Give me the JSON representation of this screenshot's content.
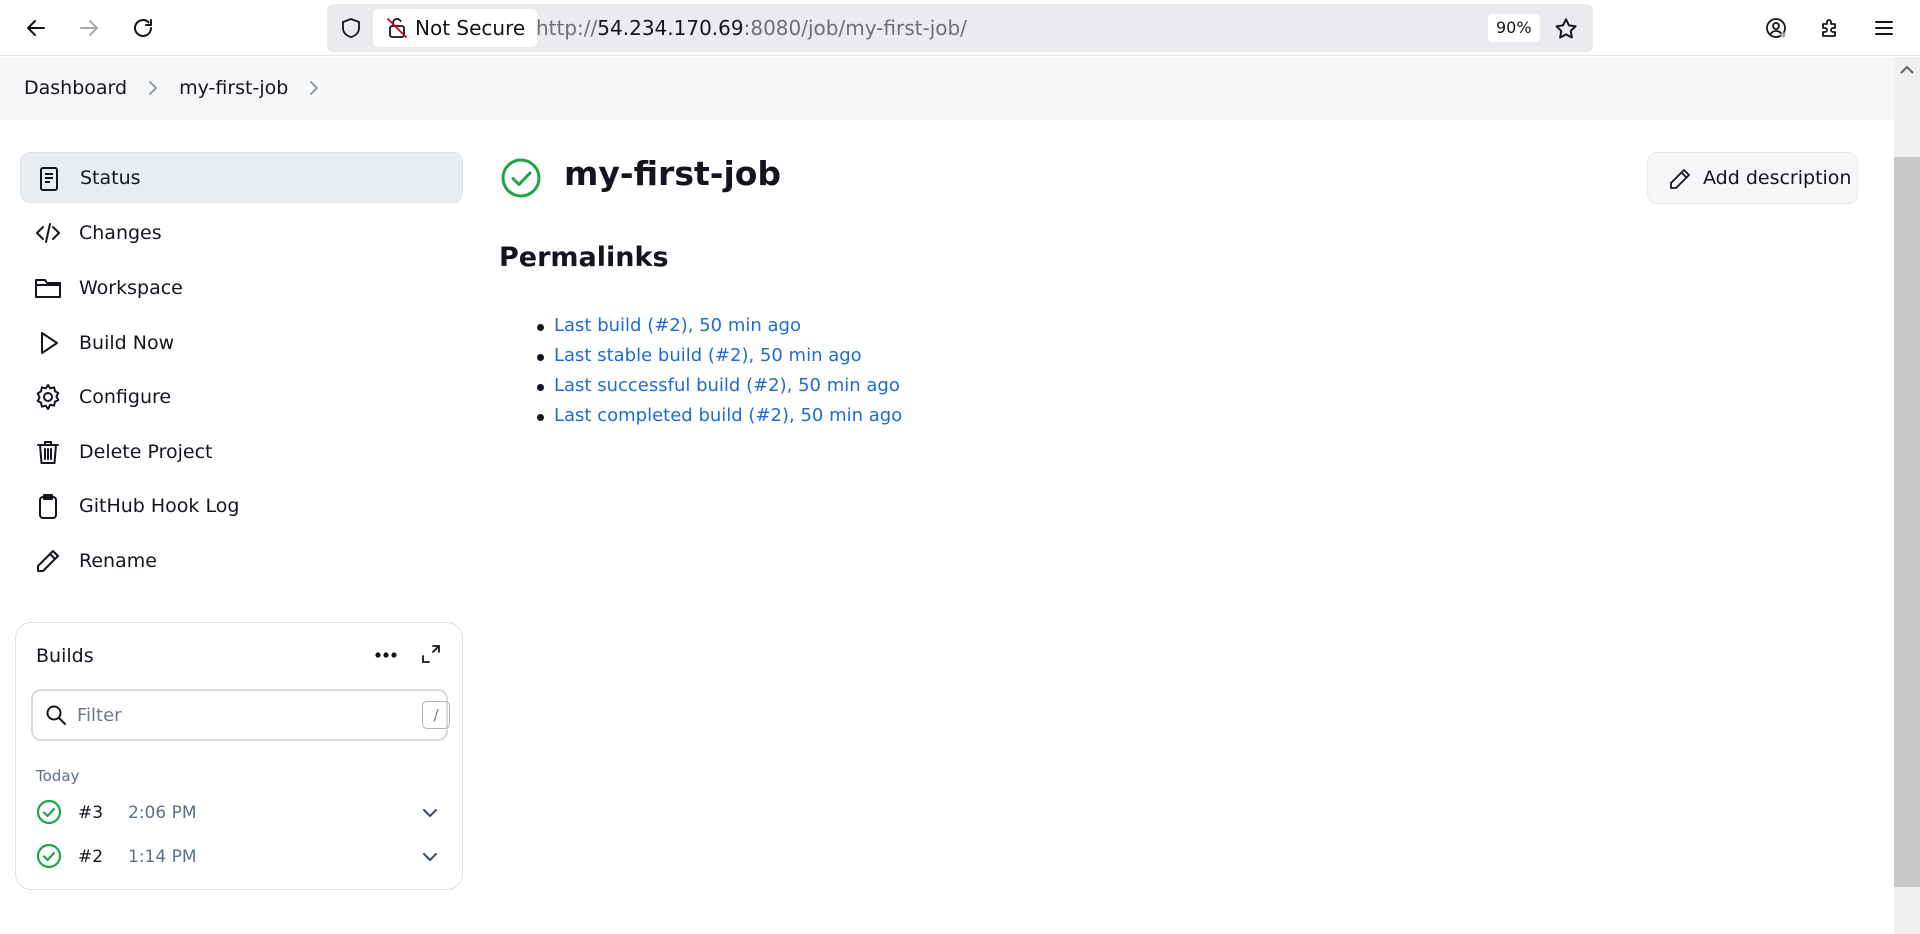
{
  "browser": {
    "security_label": "Not Secure",
    "url_prefix": "http://",
    "url_host": "54.234.170.69",
    "url_rest": ":8080/job/my-first-job/",
    "zoom": "90%"
  },
  "breadcrumb": {
    "items": [
      "Dashboard",
      "my-first-job"
    ]
  },
  "sidebar": {
    "items": [
      {
        "label": "Status",
        "icon": "status-icon",
        "active": true
      },
      {
        "label": "Changes",
        "icon": "code-icon"
      },
      {
        "label": "Workspace",
        "icon": "folder-icon"
      },
      {
        "label": "Build Now",
        "icon": "play-icon"
      },
      {
        "label": "Configure",
        "icon": "gear-icon"
      },
      {
        "label": "Delete Project",
        "icon": "trash-icon"
      },
      {
        "label": "GitHub Hook Log",
        "icon": "clipboard-icon"
      },
      {
        "label": "Rename",
        "icon": "pencil-icon"
      }
    ]
  },
  "builds": {
    "title": "Builds",
    "filter_placeholder": "Filter",
    "filter_shortcut": "/",
    "group_label": "Today",
    "rows": [
      {
        "number": "#3",
        "time": "2:06 PM",
        "status": "success"
      },
      {
        "number": "#2",
        "time": "1:14 PM",
        "status": "success"
      }
    ]
  },
  "main": {
    "title": "my-first-job",
    "add_description_label": "Add description",
    "permalinks_heading": "Permalinks",
    "permalinks": [
      "Last build (#2), 50 min ago",
      "Last stable build (#2), 50 min ago",
      "Last successful build (#2), 50 min ago",
      "Last completed build (#2), 50 min ago"
    ]
  },
  "colors": {
    "success": "#1ea446",
    "link": "#1f6bd4",
    "active_bg": "#e9edf2"
  }
}
